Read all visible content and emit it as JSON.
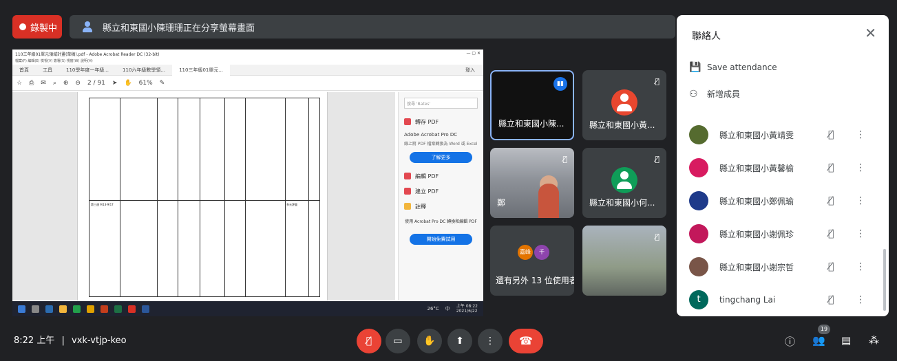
{
  "recording": {
    "label": "錄製中"
  },
  "share_banner": {
    "text": "縣立和東國小陳珊珊正在分享螢幕畫面"
  },
  "shared_screen": {
    "window_title": "110三年級01單元領域計畫(草稿).pdf - Adobe Acrobat Reader DC (32-bit)",
    "menu": "檔案(F)  編輯(E)  檢視(V)  簽署(S)  視窗(W)  說明(H)",
    "tabs": [
      "首頁",
      "工具",
      "110學年度一年級...",
      "110六年級數學領...",
      "110三年級01單元..."
    ],
    "page_indicator": "2 / 91",
    "zoom": "61%",
    "login_label": "登入",
    "side_search_placeholder": "搜尋 'Bates'",
    "side_items": [
      {
        "label": "轉存 PDF",
        "color": "#e34850"
      },
      {
        "label": "Adobe Acrobat Pro DC",
        "color": "#333333"
      },
      {
        "label": "編輯 PDF",
        "color": "#e34850"
      },
      {
        "label": "建立 PDF",
        "color": "#e34850"
      },
      {
        "label": "註釋",
        "color": "#f2b53c"
      }
    ],
    "side_desc": "線上將 PDF 檔案轉換為 Word 或 Excel",
    "learn_more": "了解更多",
    "promo_text": "使用 Acrobat Pro DC 轉換和編輯 PDF",
    "trial_btn": "開始免費試用",
    "table_left_text": "第三週 9/13-9/17",
    "table_cell_text": "多元評量",
    "taskbar": {
      "temp": "26°C",
      "ime": "中",
      "time": "上午 08:22",
      "date": "2021/6/22"
    }
  },
  "tiles": [
    {
      "name": "縣立和東國小陳...",
      "type": "dark",
      "speaking": true
    },
    {
      "name": "縣立和東國小黃...",
      "type": "avatar",
      "color": "#e8472f",
      "muted": true
    },
    {
      "name": "鄭",
      "type": "camera",
      "muted": true
    },
    {
      "name": "縣立和東國小何...",
      "type": "avatar",
      "color": "#0f9d58",
      "muted": true
    },
    {
      "name": "還有另外 13 位使用者",
      "type": "more",
      "avatars": [
        {
          "label": "嘉峰",
          "color": "#e37400"
        },
        {
          "label": "千",
          "color": "#8e44ad"
        }
      ]
    },
    {
      "name": "",
      "type": "camera2",
      "muted": true
    }
  ],
  "people_panel": {
    "title": "聯絡人",
    "actions": [
      {
        "label": "Save attendance",
        "icon": "save-icon"
      },
      {
        "label": "新增成員",
        "icon": "add-person-icon"
      }
    ],
    "participants": [
      {
        "name": "縣立和東國小黃靖雯",
        "avatar_color": "#556b2f",
        "muted": true
      },
      {
        "name": "縣立和東國小黃馨榆",
        "avatar_color": "#d81b60",
        "muted": true
      },
      {
        "name": "縣立和東國小鄭佩瑜",
        "avatar_color": "#1e3a8a",
        "muted": true
      },
      {
        "name": "縣立和東國小謝佩珍",
        "avatar_color": "#c2185b",
        "muted": true
      },
      {
        "name": "縣立和東國小謝宗哲",
        "avatar_color": "#795548",
        "muted": true
      },
      {
        "name": "tingchang Lai",
        "avatar_color": "#00695c",
        "initial": "t",
        "muted": true
      }
    ]
  },
  "bottom_bar": {
    "time": "8:22 上午",
    "separator": "|",
    "meeting_code": "vxk-vtjp-keo",
    "participant_count": "19"
  }
}
